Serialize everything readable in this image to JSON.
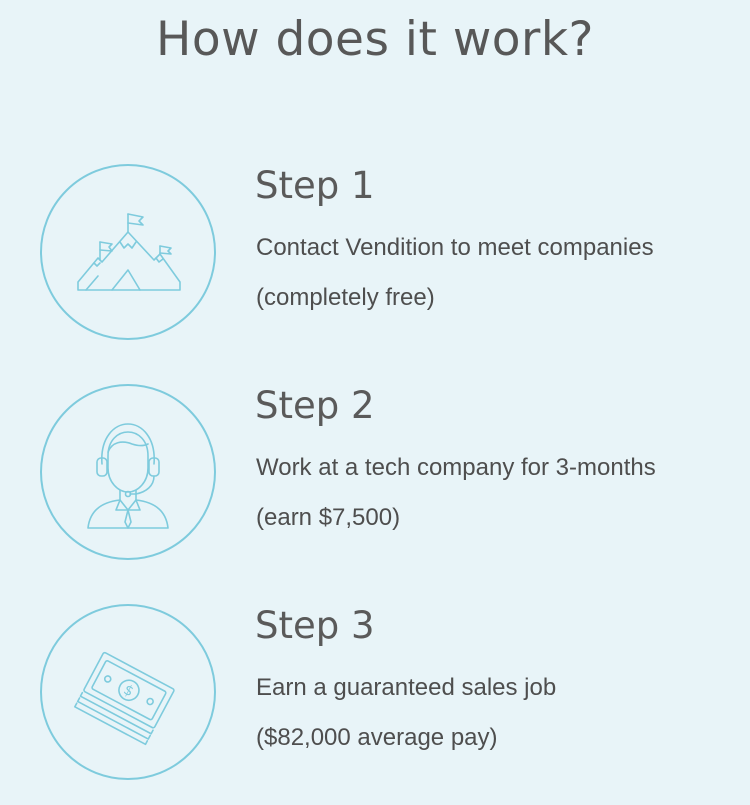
{
  "header": {
    "title": "How does it work?"
  },
  "colors": {
    "background": "#e8f4f8",
    "accent": "#7ecbdd",
    "text": "#555555"
  },
  "steps": [
    {
      "title": "Step 1",
      "line1": "Contact Vendition to meet companies",
      "line2": "(completely free)",
      "icon": "mountain-flags-icon"
    },
    {
      "title": "Step 2",
      "line1": "Work at a tech company for 3-months",
      "line2": "(earn $7,500)",
      "icon": "headset-person-icon"
    },
    {
      "title": "Step 3",
      "line1": "Earn a guaranteed sales job",
      "line2": "($82,000 average pay)",
      "icon": "money-stack-icon"
    }
  ]
}
